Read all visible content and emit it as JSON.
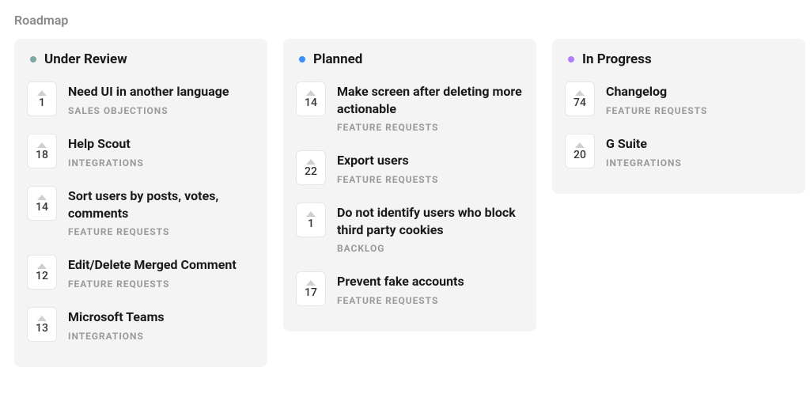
{
  "page_title": "Roadmap",
  "columns": [
    {
      "title": "Under Review",
      "dot_color": "#7aa9a4",
      "cards": [
        {
          "votes": 1,
          "title": "Need UI in another language",
          "category": "SALES OBJECTIONS"
        },
        {
          "votes": 18,
          "title": "Help Scout",
          "category": "INTEGRATIONS"
        },
        {
          "votes": 14,
          "title": "Sort users by posts, votes, comments",
          "category": "FEATURE REQUESTS"
        },
        {
          "votes": 12,
          "title": "Edit/Delete Merged Comment",
          "category": "FEATURE REQUESTS"
        },
        {
          "votes": 13,
          "title": "Microsoft Teams",
          "category": "INTEGRATIONS"
        }
      ]
    },
    {
      "title": "Planned",
      "dot_color": "#3a8eff",
      "cards": [
        {
          "votes": 14,
          "title": "Make screen after deleting more actionable",
          "category": "FEATURE REQUESTS"
        },
        {
          "votes": 22,
          "title": "Export users",
          "category": "FEATURE REQUESTS"
        },
        {
          "votes": 1,
          "title": "Do not identify users who block third party cookies",
          "category": "BACKLOG"
        },
        {
          "votes": 17,
          "title": "Prevent fake accounts",
          "category": "FEATURE REQUESTS"
        }
      ]
    },
    {
      "title": "In Progress",
      "dot_color": "#b37dff",
      "cards": [
        {
          "votes": 74,
          "title": "Changelog",
          "category": "FEATURE REQUESTS"
        },
        {
          "votes": 20,
          "title": "G Suite",
          "category": "INTEGRATIONS"
        }
      ]
    }
  ]
}
